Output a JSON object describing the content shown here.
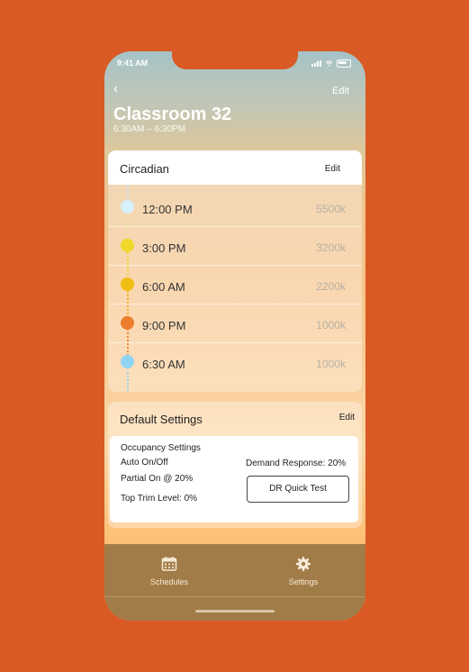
{
  "status": {
    "time": "9:41 AM"
  },
  "header": {
    "back": "‹",
    "edit": "Edit",
    "title": "Classroom 32",
    "hours": "6:30AM – 6:30PM"
  },
  "circadian": {
    "title": "Circadian",
    "edit": "Edit",
    "rows": [
      {
        "time": "12:00 PM",
        "value": "5500k",
        "color": "#d8f0fb"
      },
      {
        "time": "3:00 PM",
        "value": "3200k",
        "color": "#f1d82a"
      },
      {
        "time": "6:00 AM",
        "value": "2200k",
        "color": "#efbe12"
      },
      {
        "time": "9:00 PM",
        "value": "1000k",
        "color": "#ec7d2c"
      },
      {
        "time": "6:30 AM",
        "value": "1000k",
        "color": "#8fd4f3"
      }
    ]
  },
  "defaults": {
    "title": "Default Settings",
    "edit": "Edit",
    "occupancy_title": "Occupancy Settings",
    "auto": "Auto On/Off",
    "partial": "Partial On @ 20%",
    "trim": "Top Trim Level: 0%",
    "demand": "Demand Response: 20%",
    "dr_button": "DR Quick Test"
  },
  "tabbar": {
    "schedules": "Schedules",
    "settings": "Settings"
  },
  "colors": {
    "background": "#d95a24",
    "tabbar": "#a27c48"
  }
}
